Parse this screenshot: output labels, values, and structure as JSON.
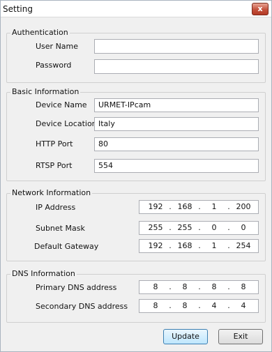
{
  "window": {
    "title": "Setting",
    "close_label": "x"
  },
  "authentication": {
    "title": "Authentication",
    "user_name_label": "User Name",
    "user_name_value": "",
    "password_label": "Password",
    "password_value": ""
  },
  "basic": {
    "title": "Basic Information",
    "device_name_label": "Device Name",
    "device_name_value": "URMET-IPcam",
    "device_location_label": "Device Location",
    "device_location_value": "Italy",
    "http_port_label": "HTTP Port",
    "http_port_value": "80",
    "rtsp_port_label": "RTSP Port",
    "rtsp_port_value": "554"
  },
  "network": {
    "title": "Network Information",
    "ip_label": "IP Address",
    "ip": [
      "192",
      "168",
      "1",
      "200"
    ],
    "mask_label": "Subnet Mask",
    "mask": [
      "255",
      "255",
      "0",
      "0"
    ],
    "gateway_label": "Default Gateway",
    "gateway": [
      "192",
      "168",
      "1",
      "254"
    ]
  },
  "dns": {
    "title": "DNS Information",
    "primary_label": "Primary DNS address",
    "primary": [
      "8",
      "8",
      "8",
      "8"
    ],
    "secondary_label": "Secondary DNS address",
    "secondary": [
      "8",
      "8",
      "4",
      "4"
    ]
  },
  "buttons": {
    "update": "Update",
    "exit": "Exit"
  },
  "ip_separator": "."
}
